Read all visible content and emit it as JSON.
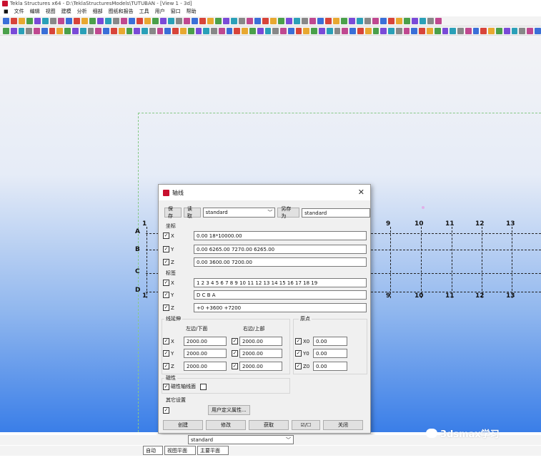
{
  "window": {
    "title": "Tekla Structures x64 - D:\\TeklaStructuresModels\\TUTUBAN  - [View 1 - 3d]"
  },
  "menu": [
    "文件",
    "编辑",
    "视图",
    "建模",
    "分析",
    "细部",
    "图纸和报告",
    "工具",
    "用户",
    "窗口",
    "帮助"
  ],
  "grid": {
    "rows_left": [
      "A",
      "B",
      "C",
      "D"
    ],
    "cols_top": [
      "1",
      "9",
      "10",
      "11",
      "12",
      "13"
    ],
    "cols_bottom": [
      "1",
      "9",
      "10",
      "11",
      "12",
      "13"
    ]
  },
  "dialog": {
    "title": "轴线",
    "save_label": "保存",
    "load_label": "读取",
    "preset_value": "standard",
    "save_as_label": "另存为",
    "save_as_value": "standard",
    "coords_title": "坐标",
    "coord_x_label": "X",
    "coord_x_value": "0.00 18*10000.00",
    "coord_y_label": "Y",
    "coord_y_value": "0.00 6265.00 7270.00 6265.00",
    "coord_z_label": "Z",
    "coord_z_value": "0.00 3600.00 7200.00",
    "labels_title": "标签",
    "label_x_label": "X",
    "label_x_value": "1 2 3 4 5 6 7 8 9 10 11 12 13 14 15 16 17 18 19",
    "label_y_label": "Y",
    "label_y_value": "D C B A",
    "label_z_label": "Z",
    "label_z_value": "+0 +3600 +7200",
    "ext_title": "线延伸",
    "ext_left_header": "左边/下面",
    "ext_right_header": "右边/上部",
    "ext_x_label": "X",
    "ext_y_label": "Y",
    "ext_z_label": "Z",
    "ext_x_left": "2000.00",
    "ext_x_right": "2000.00",
    "ext_y_left": "2000.00",
    "ext_y_right": "2000.00",
    "ext_z_left": "2000.00",
    "ext_z_right": "2000.00",
    "origin_title": "原点",
    "origin_x_label": "X0",
    "origin_x_value": "0.00",
    "origin_y_label": "Y0",
    "origin_y_value": "0.00",
    "origin_z_label": "Z0",
    "origin_z_value": "0.00",
    "magnetic_title": "磁性",
    "magnetic_label": "磁性轴线面",
    "other_title": "其它设置",
    "udp_label": "用户定义属性...",
    "create_label": "创建",
    "modify_label": "修改",
    "get_label": "获取",
    "toggle_label": "☑/☐",
    "close_label": "关闭"
  },
  "bottom": {
    "standard_value": "standard",
    "auto_label": "自动",
    "view_plane_label": "视图平面",
    "main_plane_label": "主要平面"
  },
  "watermark": "3dsmax学习"
}
